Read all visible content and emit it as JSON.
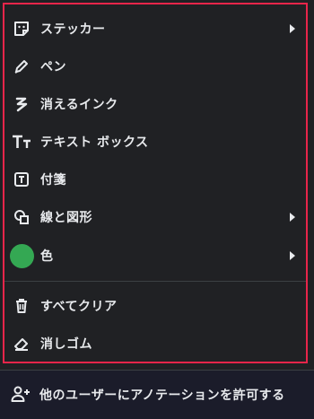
{
  "menu": {
    "items": [
      {
        "label": "ステッカー",
        "icon": "sticker-icon",
        "submenu": true
      },
      {
        "label": "ペン",
        "icon": "pen-icon",
        "submenu": false
      },
      {
        "label": "消えるインク",
        "icon": "disappearing-ink-icon",
        "submenu": false
      },
      {
        "label": "テキスト ボックス",
        "icon": "text-box-icon",
        "submenu": false
      },
      {
        "label": "付箋",
        "icon": "sticky-note-icon",
        "submenu": false
      },
      {
        "label": "線と図形",
        "icon": "shapes-icon",
        "submenu": true
      },
      {
        "label": "色",
        "icon": "color-swatch-icon",
        "submenu": true,
        "color": "#34a853"
      },
      {
        "label": "すべてクリア",
        "icon": "trash-icon",
        "submenu": false
      },
      {
        "label": "消しゴム",
        "icon": "eraser-icon",
        "submenu": false
      }
    ]
  },
  "footer": {
    "label": "他のユーザーにアノテーションを許可する",
    "icon": "add-person-icon"
  },
  "colors": {
    "background": "#202124",
    "highlight_border": "#e8254a",
    "footer_background": "#1b1c2a",
    "selected_color": "#34a853"
  }
}
